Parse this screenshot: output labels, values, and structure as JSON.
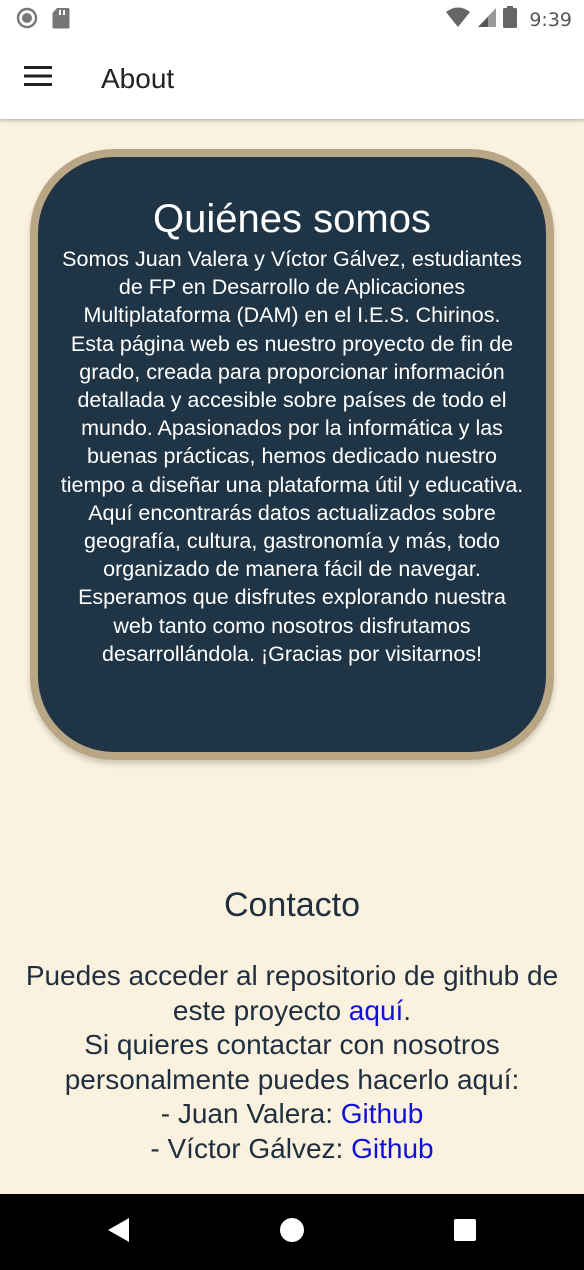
{
  "status_bar": {
    "time": "9:39",
    "icons": [
      "record-icon",
      "sd-card-icon",
      "wifi-icon",
      "signal-icon",
      "battery-icon"
    ]
  },
  "app_bar": {
    "title": "About",
    "menu_icon": "hamburger-menu-icon"
  },
  "about_card": {
    "title": "Quiénes somos",
    "body": "Somos Juan Valera y Víctor Gálvez, estudiantes de FP en Desarrollo de Aplicaciones Multiplataforma (DAM) en el I.E.S. Chirinos. Esta página web es nuestro proyecto de fin de grado, creada para proporcionar información detallada y accesible sobre países de todo el mundo. Apasionados por la informática y las buenas prácticas, hemos dedicado nuestro tiempo a diseñar una plataforma útil y educativa. Aquí encontrarás datos actualizados sobre geografía, cultura, gastronomía y más, todo organizado de manera fácil de navegar. Esperamos que disfrutes explorando nuestra web tanto como nosotros disfrutamos desarrollándola. ¡Gracias por visitarnos!"
  },
  "contact": {
    "title": "Contacto",
    "repo_text": "Puedes acceder al repositorio de github de este proyecto ",
    "repo_link": "aquí",
    "repo_end": ".",
    "personal_text": "Si quieres contactar con nosotros personalmente puedes hacerlo aquí:",
    "person1_prefix": "- Juan Valera: ",
    "person1_link": "Github",
    "person2_prefix": "- Víctor Gálvez: ",
    "person2_link": "Github"
  },
  "nav_bar": {
    "icons": [
      "back-icon",
      "home-icon",
      "recents-icon"
    ]
  },
  "colors": {
    "page_background": "#fbf1df",
    "card_background": "#1f3545",
    "card_border": "#b8a685",
    "link": "#1010d8",
    "text": "#1f2f3f"
  }
}
